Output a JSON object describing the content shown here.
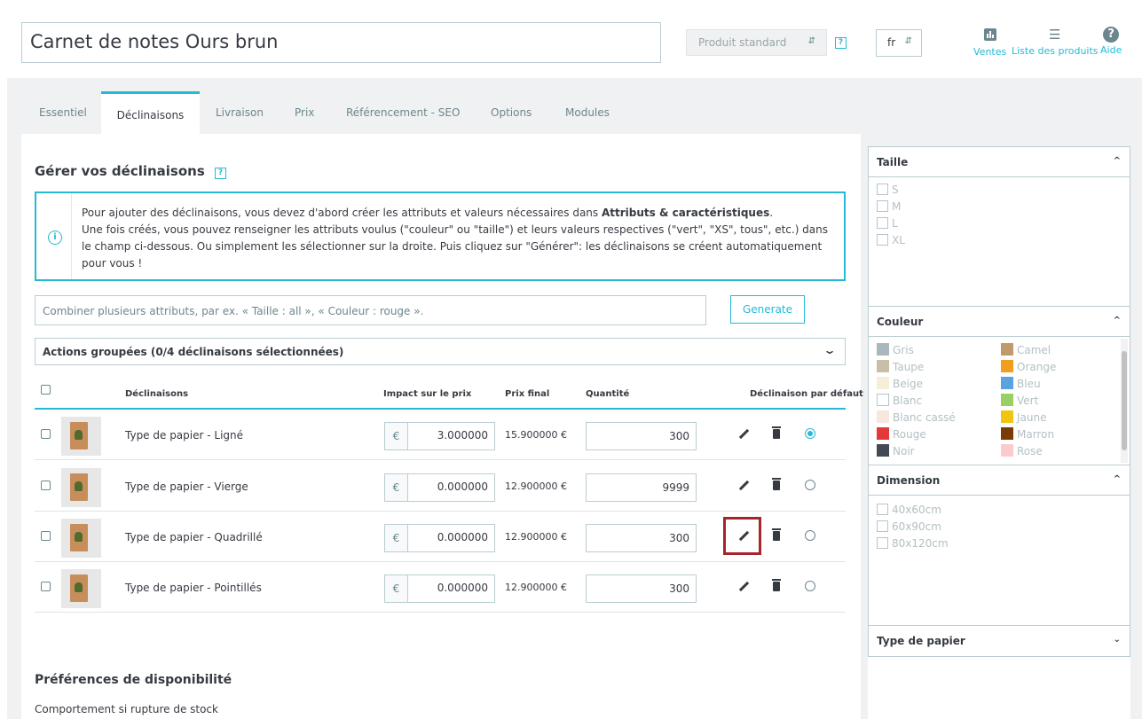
{
  "header": {
    "product_name": "Carnet de notes Ours brun",
    "product_type": "Produit standard",
    "help_mark": "?",
    "language": "fr",
    "toolbar": [
      {
        "icon": "sales-chart-icon",
        "label": "Ventes"
      },
      {
        "icon": "list-icon",
        "label": "Liste des produits"
      },
      {
        "icon": "help-icon",
        "label": "Aide"
      }
    ]
  },
  "tabs": [
    "Essentiel",
    "Déclinaisons",
    "Livraison",
    "Prix",
    "Référencement - SEO",
    "Options",
    "Modules"
  ],
  "active_tab": "Déclinaisons",
  "combinations": {
    "heading": "Gérer vos déclinaisons",
    "alert": {
      "line1_pre": "Pour ajouter des déclinaisons, vous devez d'abord créer les attributs et valeurs nécessaires dans ",
      "line1_link": "Attributs & caractéristiques",
      "line1_post": ".",
      "line2": "Une fois créés, vous pouvez renseigner les attributs voulus (\"couleur\" ou \"taille\") et leurs valeurs respectives (\"vert\", \"XS\", tous\", etc.) dans le champ ci-dessous. Ou simplement les sélectionner sur la droite. Puis cliquez sur \"Générer\": les déclinaisons se créent automatiquement pour vous !"
    },
    "combine_placeholder": "Combiner plusieurs attributs, par ex. « Taille : all », « Couleur : rouge ».",
    "generate_label": "Generate",
    "bulk_actions": "Actions groupées (0/4 déclinaisons sélectionnées)",
    "columns": {
      "name": "Déclinaisons",
      "impact": "Impact sur le prix",
      "final": "Prix final",
      "qty": "Quantité",
      "default": "Déclinaison par défaut"
    },
    "currency": "€",
    "rows": [
      {
        "name": "Type de papier - Ligné",
        "impact": "3.000000",
        "final": "15.900000 €",
        "qty": "300",
        "default": true
      },
      {
        "name": "Type de papier - Vierge",
        "impact": "0.000000",
        "final": "12.900000 €",
        "qty": "9999",
        "default": false
      },
      {
        "name": "Type de papier - Quadrillé",
        "impact": "0.000000",
        "final": "12.900000 €",
        "qty": "300",
        "default": false
      },
      {
        "name": "Type de papier - Pointillés",
        "impact": "0.000000",
        "final": "12.900000 €",
        "qty": "300",
        "default": false
      }
    ]
  },
  "availability": {
    "heading": "Préférences de disponibilité",
    "out_of_stock_label": "Comportement si rupture de stock"
  },
  "filters": {
    "taille": {
      "title": "Taille",
      "items": [
        "S",
        "M",
        "L",
        "XL"
      ]
    },
    "couleur": {
      "title": "Couleur",
      "left": [
        {
          "name": "Gris",
          "color": "#aab7bf"
        },
        {
          "name": "Taupe",
          "color": "#c8bfa9"
        },
        {
          "name": "Beige",
          "color": "#f4efd6"
        },
        {
          "name": "Blanc",
          "color": "#ffffff"
        },
        {
          "name": "Blanc cassé",
          "color": "#f7e8dd"
        },
        {
          "name": "Rouge",
          "color": "#e3393b"
        },
        {
          "name": "Noir",
          "color": "#434a54"
        }
      ],
      "right": [
        {
          "name": "Camel",
          "color": "#c19a6b"
        },
        {
          "name": "Orange",
          "color": "#f39d1f"
        },
        {
          "name": "Bleu",
          "color": "#5ba2e0"
        },
        {
          "name": "Vert",
          "color": "#99d065"
        },
        {
          "name": "Jaune",
          "color": "#f1c40f"
        },
        {
          "name": "Marron",
          "color": "#7b3b05"
        },
        {
          "name": "Rose",
          "color": "#fccacd"
        }
      ]
    },
    "dimension": {
      "title": "Dimension",
      "items": [
        "40x60cm",
        "60x90cm",
        "80x120cm"
      ]
    },
    "papier": {
      "title": "Type de papier"
    }
  }
}
